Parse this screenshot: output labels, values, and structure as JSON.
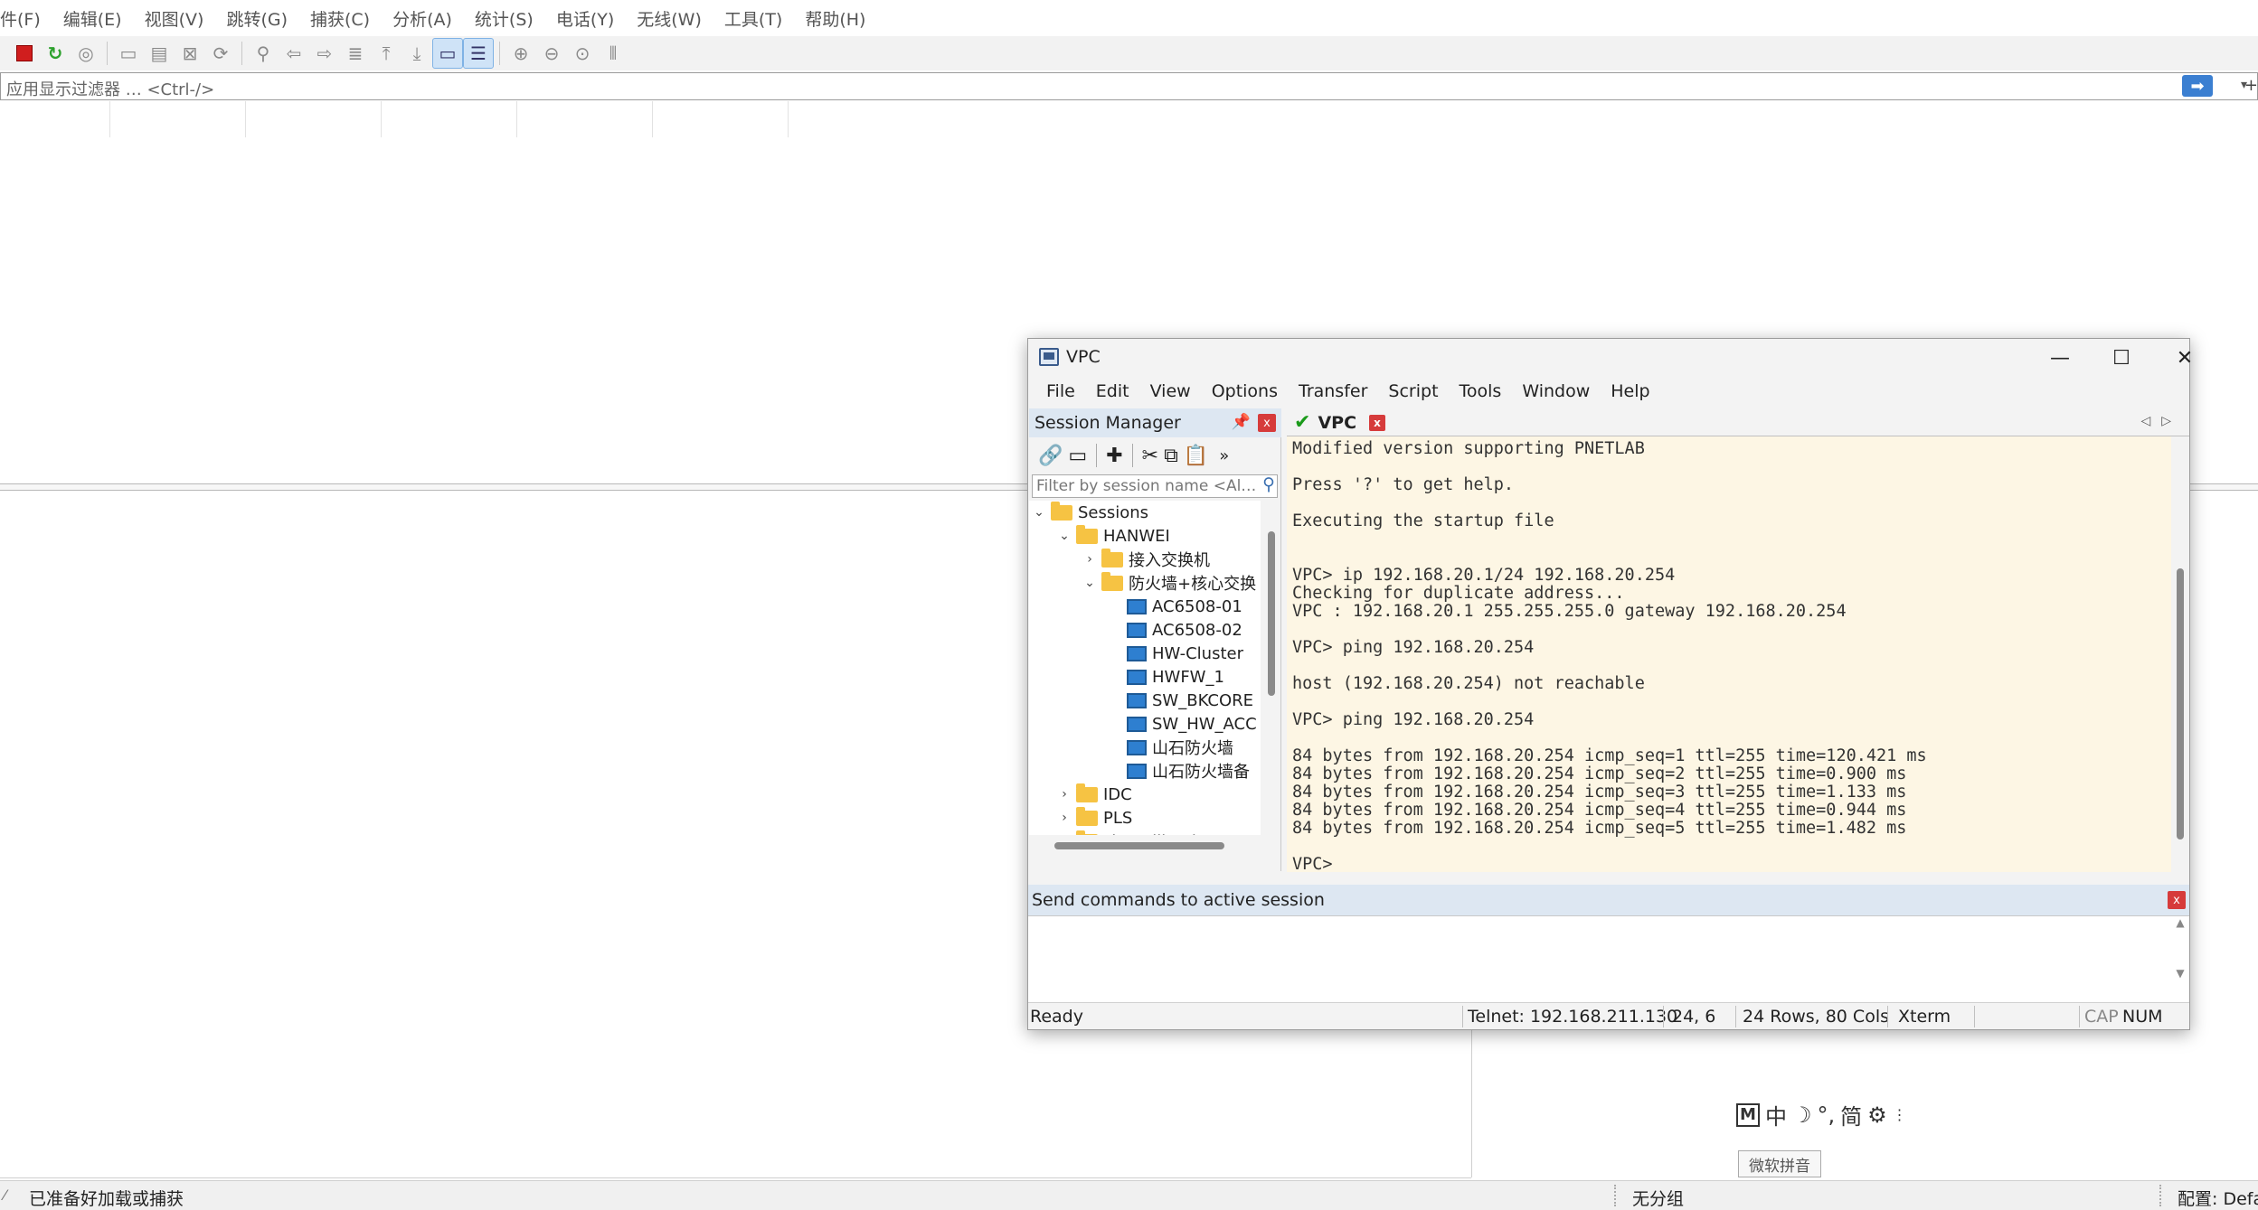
{
  "wireshark": {
    "menu": [
      "件(F)",
      "编辑(E)",
      "视图(V)",
      "跳转(G)",
      "捕获(C)",
      "分析(A)",
      "统计(S)",
      "电话(Y)",
      "无线(W)",
      "工具(T)",
      "帮助(H)"
    ],
    "filter_placeholder": "应用显示过滤器 … <Ctrl-/>",
    "status": {
      "ready": "已准备好加载或捕获",
      "group": "无分组",
      "profile": "配置: Defa"
    }
  },
  "ime": {
    "mode": "M",
    "punct": "°,",
    "simplified": "简",
    "label": "微软拼音"
  },
  "crt": {
    "title": "VPC",
    "menu": [
      "File",
      "Edit",
      "View",
      "Options",
      "Transfer",
      "Script",
      "Tools",
      "Window",
      "Help"
    ],
    "session_manager": {
      "title": "Session Manager",
      "filter_placeholder": "Filter by session name <Al…",
      "tree": [
        {
          "label": "Sessions",
          "type": "folder",
          "expanded": true
        },
        {
          "label": "HANWEI",
          "type": "folder",
          "expanded": true
        },
        {
          "label": "接入交换机",
          "type": "folder",
          "expanded": false
        },
        {
          "label": "防火墙+核心交换",
          "type": "folder",
          "expanded": true
        },
        {
          "label": "AC6508-01",
          "type": "session"
        },
        {
          "label": "AC6508-02",
          "type": "session"
        },
        {
          "label": "HW-Cluster",
          "type": "session"
        },
        {
          "label": "HWFW_1",
          "type": "session"
        },
        {
          "label": "SW_BKCORE",
          "type": "session"
        },
        {
          "label": "SW_HW_ACC",
          "type": "session"
        },
        {
          "label": "山石防火墙",
          "type": "session"
        },
        {
          "label": "山石防火墙备",
          "type": "session"
        },
        {
          "label": "IDC",
          "type": "folder",
          "expanded": false
        },
        {
          "label": "PLS",
          "type": "folder",
          "expanded": false
        },
        {
          "label": "shunyijiamin",
          "type": "folder",
          "expanded": false
        }
      ]
    },
    "tab": {
      "label": "VPC",
      "status": "connected"
    },
    "terminal_lines": [
      "Modified version supporting PNETLAB",
      "",
      "Press '?' to get help.",
      "",
      "Executing the startup file",
      "",
      "",
      "VPC> ip 192.168.20.1/24 192.168.20.254",
      "Checking for duplicate address...",
      "VPC : 192.168.20.1 255.255.255.0 gateway 192.168.20.254",
      "",
      "VPC> ping 192.168.20.254",
      "",
      "host (192.168.20.254) not reachable",
      "",
      "VPC> ping 192.168.20.254",
      "",
      "84 bytes from 192.168.20.254 icmp_seq=1 ttl=255 time=120.421 ms",
      "84 bytes from 192.168.20.254 icmp_seq=2 ttl=255 time=0.900 ms",
      "84 bytes from 192.168.20.254 icmp_seq=3 ttl=255 time=1.133 ms",
      "84 bytes from 192.168.20.254 icmp_seq=4 ttl=255 time=0.944 ms",
      "84 bytes from 192.168.20.254 icmp_seq=5 ttl=255 time=1.482 ms",
      "",
      "VPC>"
    ],
    "command_window_title": "Send commands to active session",
    "status": {
      "ready": "Ready",
      "connection": "Telnet: 192.168.211.130",
      "cursor": "24,   6",
      "size": "24 Rows, 80 Cols",
      "emulation": "Xterm",
      "cap": "CAP",
      "num": "NUM"
    }
  }
}
